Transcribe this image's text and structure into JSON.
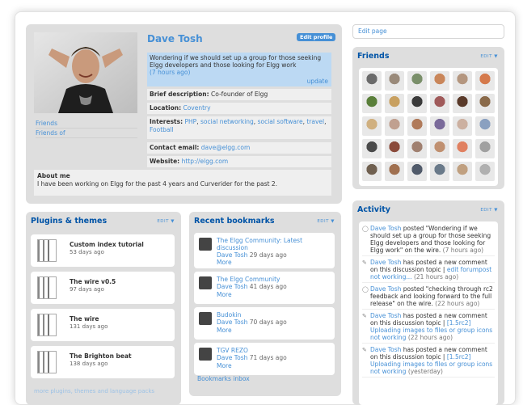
{
  "profile": {
    "name": "Dave Tosh",
    "edit_profile": "Edit profile",
    "status_text": "Wondering if we should set up a group for those seeking Elgg developers and those looking for Elgg work",
    "status_time": "(7 hours ago)",
    "status_update": "update",
    "side_links": [
      "Friends",
      "Friends of"
    ],
    "brief_label": "Brief description:",
    "brief_value": "Co-founder of Elgg",
    "location_label": "Location:",
    "location_value": "Coventry",
    "interests_label": "Interests:",
    "interests": [
      "PHP",
      "social networking",
      "social software",
      "travel",
      "Football"
    ],
    "email_label": "Contact email:",
    "email_value": "dave@elgg.com",
    "website_label": "Website:",
    "website_value": "http://elgg.com",
    "about_label": "About me",
    "about_text": "I have been working on Elgg for the past 4 years and Curverider for the past 2."
  },
  "edit_page": "Edit page",
  "friends": {
    "title": "Friends",
    "edit": "EDIT ▼",
    "colors": [
      "#6b6b6b",
      "#9a8a7a",
      "#7a8f6a",
      "#c9865a",
      "#b4967f",
      "#d57a4c",
      "#5a7f3a",
      "#c8a060",
      "#3a3a3a",
      "#a05a5a",
      "#5a3a2a",
      "#8a6a4a",
      "#d0b080",
      "#c0a090",
      "#b07a5a",
      "#7a6a9a",
      "#ccb0a0",
      "#8aa0c0",
      "#4a4a4a",
      "#8a4a3a",
      "#a08070",
      "#c09070",
      "#e08060",
      "#a0a0a0",
      "#706050",
      "#a07050",
      "#505a6a",
      "#6a7a8a",
      "#c0a080",
      "#b0b0b0"
    ]
  },
  "plugins": {
    "title": "Plugins & themes",
    "edit": "EDIT ▼",
    "items": [
      {
        "name": "Custom index tutorial",
        "age": "53 days ago"
      },
      {
        "name": "The wire v0.5",
        "age": "97 days ago"
      },
      {
        "name": "The wire",
        "age": "131 days ago"
      },
      {
        "name": "The Brighton beat",
        "age": "138 days ago"
      }
    ],
    "more": "more plugins, themes and language packs"
  },
  "bookmarks": {
    "title": "Recent bookmarks",
    "edit": "EDIT ▼",
    "items": [
      {
        "title": "The Elgg Community: Latest discussion",
        "author": "Dave Tosh",
        "age": "29 days ago",
        "more": "More"
      },
      {
        "title": "The Elgg Community",
        "author": "Dave Tosh",
        "age": "41 days ago",
        "more": "More"
      },
      {
        "title": "Budokin",
        "author": "Dave Tosh",
        "age": "70 days ago",
        "more": "More"
      },
      {
        "title": "TGV REZO",
        "author": "Dave Tosh",
        "age": "71 days ago",
        "more": "More"
      }
    ],
    "inbox": "Bookmarks inbox"
  },
  "activity": {
    "title": "Activity",
    "edit": "EDIT ▼",
    "items": [
      {
        "icon": "speech-bubble-icon",
        "user": "Dave Tosh",
        "text": "posted \"Wondering if we should set up a group for those seeking Elgg developers and those looking for Elgg work\" on the wire.",
        "time": "(7 hours ago)"
      },
      {
        "icon": "discussion-icon",
        "user": "Dave Tosh",
        "text": "has posted a new comment on this discussion topic |",
        "link": "edit forumpost not working...",
        "time": "(21 hours ago)"
      },
      {
        "icon": "speech-bubble-icon",
        "user": "Dave Tosh",
        "text": "posted \"checking through rc2 feedback and looking forward to the full release\" on the wire.",
        "time": "(22 hours ago)"
      },
      {
        "icon": "discussion-icon",
        "user": "Dave Tosh",
        "text": "has posted a new comment on this discussion topic |",
        "link": "[1.5rc2] Uploading images to files or group icons not working",
        "time": "(22 hours ago)"
      },
      {
        "icon": "discussion-icon",
        "user": "Dave Tosh",
        "text": "has posted a new comment on this discussion topic |",
        "link": "[1.5rc2] Uploading images to files or group icons not working",
        "time": "(yesterday)"
      }
    ]
  }
}
